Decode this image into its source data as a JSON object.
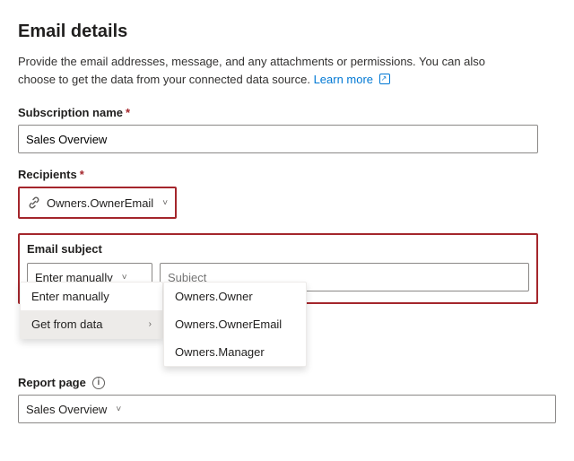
{
  "page": {
    "title": "Email details",
    "description": "Provide the email addresses, message, and any attachments or permissions. You can also choose to get the data from your connected data source.",
    "learn_more_label": "Learn more"
  },
  "subscription_name": {
    "label": "Subscription name",
    "required": true,
    "value": "Sales Overview"
  },
  "recipients": {
    "label": "Recipients",
    "required": true,
    "selected_value": "Owners.OwnerEmail",
    "chevron": "˅"
  },
  "email_subject": {
    "label": "Email subject",
    "dropdown_label": "Enter manually",
    "chevron": "˅",
    "subject_placeholder": "Subject",
    "dropdown_items": [
      {
        "label": "Enter manually",
        "has_submenu": false
      },
      {
        "label": "Get from data",
        "has_submenu": true
      }
    ],
    "submenu_items": [
      {
        "label": "Owners.Owner"
      },
      {
        "label": "Owners.OwnerEmail"
      },
      {
        "label": "Owners.Manager"
      }
    ]
  },
  "report_page": {
    "label": "Report page",
    "has_info": true,
    "selected_value": "Sales Overview",
    "chevron": "˅"
  },
  "icons": {
    "chain": "🔗",
    "info": "i",
    "external_link": "↗"
  }
}
